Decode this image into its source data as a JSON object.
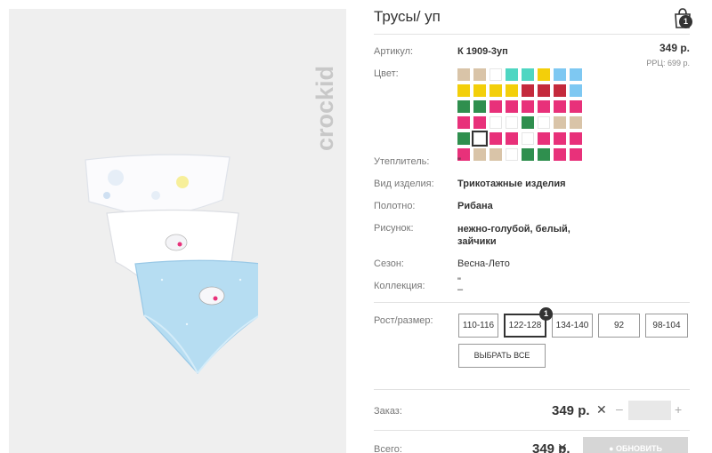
{
  "brand": {
    "logo_text": "crockid"
  },
  "product": {
    "title": "Трусы/ уп",
    "cart_count": "1",
    "price": "349 р.",
    "rrp": "РРЦ: 699 р."
  },
  "specs": [
    {
      "label": "Артикул:",
      "value": "К 1909-3уп"
    },
    {
      "label": "Цвет:",
      "value": ""
    },
    {
      "label": "Утеплитель:",
      "value": "\""
    },
    {
      "label": "Вид изделия:",
      "value": "Трикотажные изделия"
    },
    {
      "label": "Полотно:",
      "value": "Рибана"
    },
    {
      "label": "Рисунок:",
      "value": "нежно-голубой, белый, зайчики"
    },
    {
      "label": "Сезон:",
      "value": "Весна-Лето"
    },
    {
      "label": "Коллекция:",
      "value": "\"\n–"
    }
  ],
  "colors": [
    "#d9c4a8",
    "#d9c4a8",
    "#ffffff",
    "#4fd6c2",
    "#4fd6c2",
    "#f3cf0a",
    "#7ec8f2",
    "#7ec8f2",
    "#f3cf0a",
    "#f3cf0a",
    "#f3cf0a",
    "#f3cf0a",
    "#c42a3c",
    "#c42a3c",
    "#c42a3c",
    "#7ec8f2",
    "#2f8f4e",
    "#2f8f4e",
    "#e8317a",
    "#e8317a",
    "#e8317a",
    "#e8317a",
    "#e8317a",
    "#e8317a",
    "#e8317a",
    "#e8317a",
    "#ffffff",
    "#ffffff",
    "#2f8f4e",
    "#ffffff",
    "#d9c4a8",
    "#d9c4a8",
    "#2f8f4e",
    "#ffffff",
    "#e8317a",
    "#e8317a",
    "#ffffff",
    "#e8317a",
    "#e8317a",
    "#e8317a",
    "#e8317a",
    "#d9c4a8",
    "#d9c4a8",
    "#ffffff",
    "#2f8f4e",
    "#2f8f4e",
    "#e8317a",
    "#e8317a"
  ],
  "size": {
    "label": "Рост/размер:",
    "options": [
      "110-116",
      "122-128",
      "134-140",
      "92",
      "98-104"
    ],
    "selected_badge": "1",
    "select_all": "ВЫБРАТЬ ВСЕ"
  },
  "order": {
    "label": "Заказ:",
    "price": "349 р.",
    "close": "✕",
    "minus": "–",
    "plus": "+",
    "qty": ""
  },
  "total": {
    "label": "Всего:",
    "price": "349 р.",
    "update_button": "ОБНОВИТЬ"
  }
}
